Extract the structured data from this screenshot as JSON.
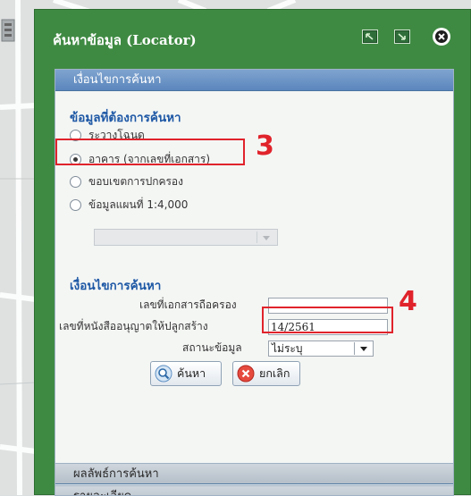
{
  "dialog": {
    "title": "ค้นหาข้อมูล (Locator)",
    "buttons": [
      "maximize-icon",
      "restore-icon",
      "close-icon"
    ]
  },
  "search_condition": {
    "header": "เงื่อนไขการค้นหา",
    "data_section_label": "ข้อมูลที่ต้องการค้นหา",
    "options": [
      {
        "label": "ระวางโฉนด",
        "checked": false
      },
      {
        "label": "อาคาร (จากเลขที่เอกสาร)",
        "checked": true
      },
      {
        "label": "ขอบเขตการปกครอง",
        "checked": false
      },
      {
        "label": "ข้อมูลแผนที่ 1:4,000",
        "checked": false
      }
    ],
    "condition_label": "เงื่อนไขการค้นหา",
    "fields": {
      "doc_number_label": "เลขที่เอกสารถือครอง",
      "doc_number_value": "",
      "permit_number_label": "เลขที่หนังสืออนุญาตให้ปลูกสร้าง",
      "permit_number_value": "14/2561",
      "status_label": "สถานะข้อมูล",
      "status_value": "ไม่ระบุ"
    },
    "search_button": "ค้นหา",
    "cancel_button": "ยกเลิก"
  },
  "results_header": "ผลลัพธ์การค้นหา",
  "details_header": "รายละเอียด",
  "annotations": {
    "step3": "3",
    "step4": "4"
  },
  "colors": {
    "dialog_bg": "#3f8a43",
    "accent_red": "#e0232b",
    "header_blue": "#5b86bd"
  }
}
